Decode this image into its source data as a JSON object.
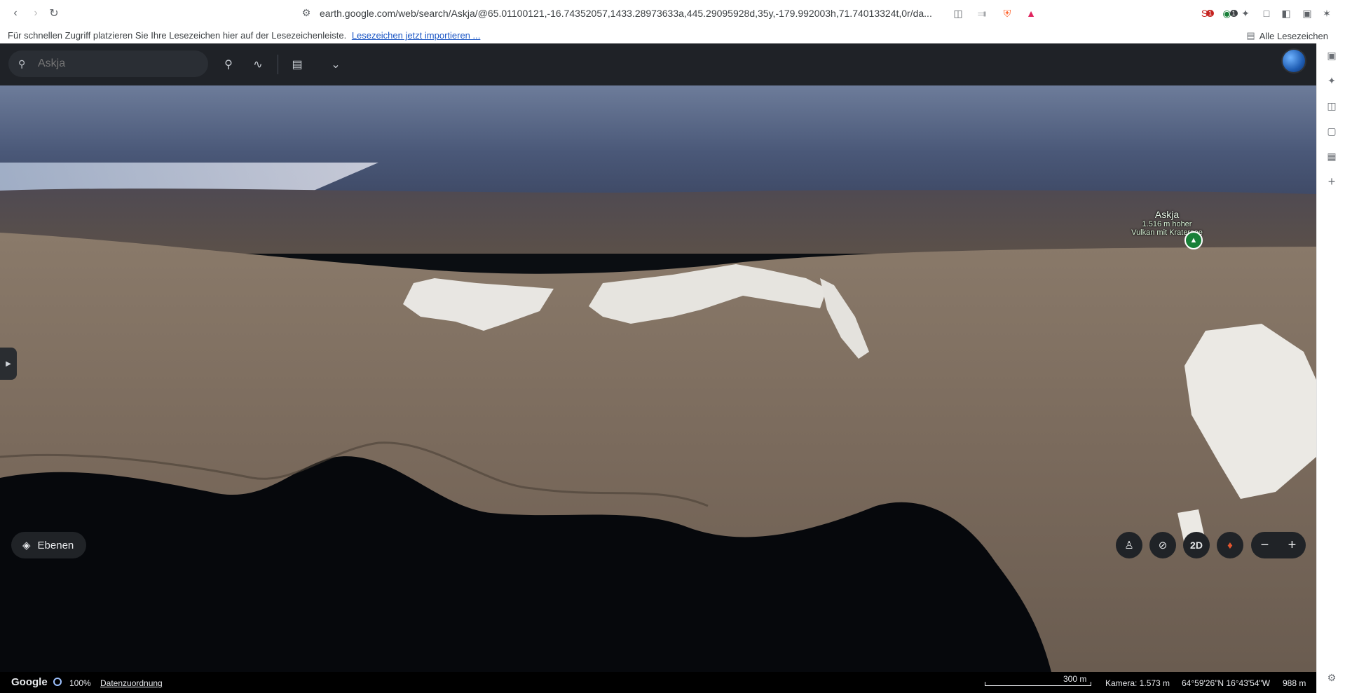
{
  "browser": {
    "url": "earth.google.com/web/search/Askja/@65.01100121,-16.74352057,1433.28973633a,445.29095928d,35y,-179.992003h,71.74013324t,0r/da...",
    "bookmarks_prompt": "Für schnellen Zugriff platzieren Sie Ihre Lesezeichen hier auf der Lesezeichenleiste.",
    "bookmarks_import_link": "Lesezeichen jetzt importieren ...",
    "all_bookmarks": "Alle Lesezeichen",
    "badge_shield_count": "1",
    "badge_ext_count": "1"
  },
  "earth": {
    "search_placeholder": "Askja",
    "place_label": {
      "title": "Askja",
      "subtitle_line1": "1.516 m hoher",
      "subtitle_line2": "Vulkan mit Kratersee"
    },
    "layers_label": "Ebenen",
    "mode_2d": "2D",
    "zoom_minus": "−",
    "zoom_plus": "+",
    "status": {
      "brand": "Google",
      "load_percent": "100%",
      "attribution": "Datenzuordnung",
      "scale": "300 m",
      "camera": "Kamera: 1.573 m",
      "coordinates": "64°59'26\"N 16°43'54\"W",
      "elevation": "988 m"
    }
  },
  "colors": {
    "chrome_bg": "#ffffff",
    "earth_toolbar": "#1f2227",
    "button_bg": "#202327",
    "place_pin": "#188038"
  }
}
